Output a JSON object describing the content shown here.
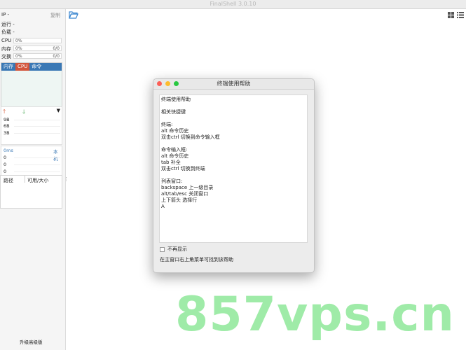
{
  "window": {
    "title": "FinalShell 3.0.10"
  },
  "sidebar": {
    "ip_label": "IP -",
    "copy_label": "复制",
    "uptime_label": "运行 -",
    "load_label": "负载 -",
    "meters": [
      {
        "label": "CPU",
        "percent": "0%",
        "value": ""
      },
      {
        "label": "内存",
        "percent": "0%",
        "value": "0/0"
      },
      {
        "label": "交换",
        "percent": "0%",
        "value": "0/0"
      }
    ],
    "proc_tabs": [
      "内存",
      "CPU",
      "命令"
    ],
    "net": {
      "up_arrow": "🡑",
      "down_arrow": "🡓",
      "dropdown_arrow": "▼",
      "ticks": [
        "9B",
        "6B",
        "3B"
      ]
    },
    "ping": {
      "latency": "0ms",
      "host": "本机",
      "ticks": [
        "0",
        "0",
        "0"
      ]
    },
    "files": {
      "col_path": "路径",
      "col_avail": "可用/大小"
    },
    "upgrade_label": "升级高级版"
  },
  "dialog": {
    "title": "终端使用帮助",
    "lines": [
      "终端使用帮助",
      "",
      "相关快捷键",
      "",
      "终端:",
      "alt 命令历史",
      "双击ctrl 切换到命令输入框",
      "",
      "命令输入框:",
      "alt 命令历史",
      "tab 补全",
      "双击ctrl 切换到终端",
      "",
      "列表窗口:",
      "backspace 上一级目录",
      "alt/tab/esc 关闭窗口",
      "上下箭头 选择行",
      "A"
    ],
    "dont_show_label": "不再显示",
    "find_help_label": "在主窗口右上角菜单可找到该帮助"
  },
  "watermark": "857vps.cn",
  "colors": {
    "accent_blue": "#3a78b5",
    "cpu_red": "#d2553c",
    "watermark_green": "#8fe89a"
  }
}
